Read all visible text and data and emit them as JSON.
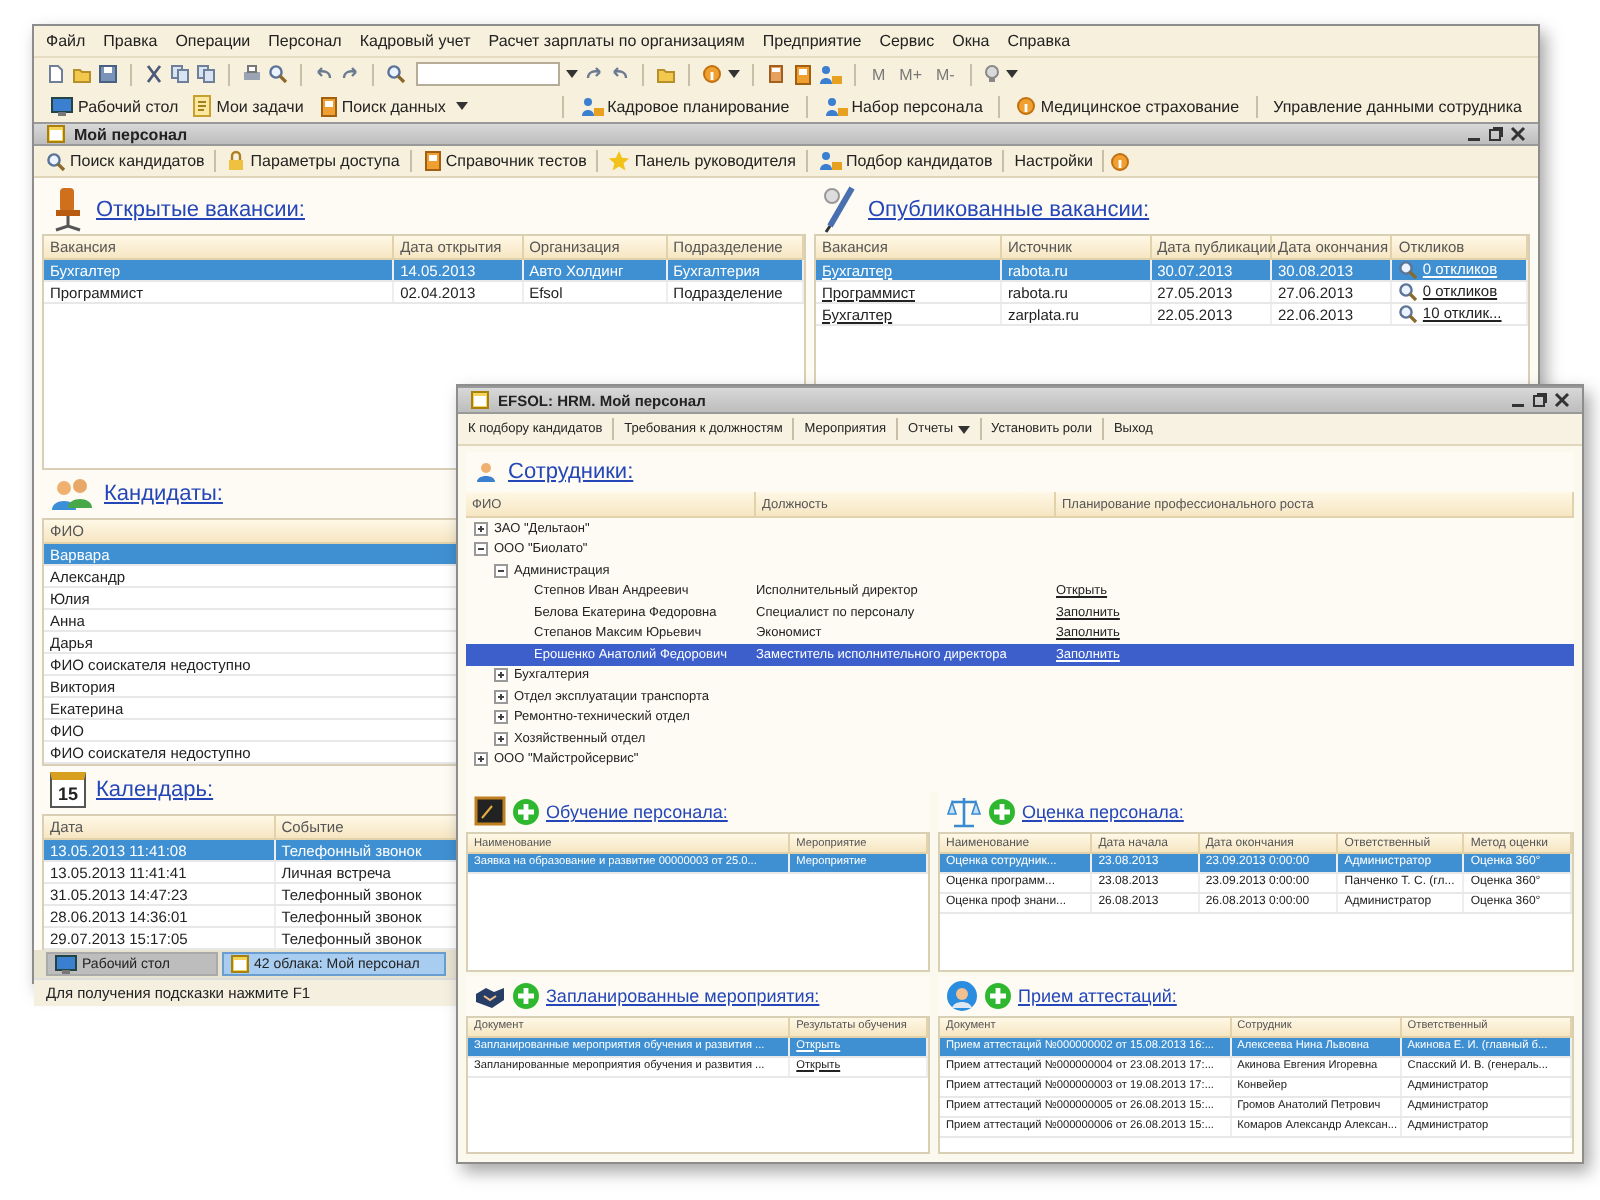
{
  "main_window": {
    "menu": [
      "Файл",
      "Правка",
      "Операции",
      "Персонал",
      "Кадровый учет",
      "Расчет зарплаты по организациям",
      "Предприятие",
      "Сервис",
      "Окна",
      "Справка"
    ],
    "memory_buttons": [
      "M",
      "M+",
      "M-"
    ],
    "shortcuts": [
      "Рабочий стол",
      "Мои задачи",
      "Поиск данных"
    ],
    "quick_links": [
      "Кадровое планирование",
      "Набор персонала",
      "Медицинское страхование",
      "Управление данными сотрудника"
    ],
    "title": "Мой персонал",
    "command_bar": [
      "Поиск кандидатов",
      "Параметры доступа",
      "Справочник тестов",
      "Панель руководителя",
      "Подбор кандидатов",
      "Настройки"
    ],
    "open_vacancies": {
      "title": "Открытые вакансии:",
      "columns": [
        "Вакансия",
        "Дата открытия",
        "Организация",
        "Подразделение"
      ],
      "rows": [
        {
          "cells": [
            "Бухгалтер",
            "14.05.2013",
            "Авто Холдинг",
            "Бухгалтерия"
          ],
          "selected": true
        },
        {
          "cells": [
            "Программист",
            "02.04.2013",
            "Efsol",
            "Подразделение"
          ],
          "selected": false
        }
      ]
    },
    "published_vacancies": {
      "title": "Опубликованные вакансии:",
      "columns": [
        "Вакансия",
        "Источник",
        "Дата публикации",
        "Дата окончания",
        "Откликов"
      ],
      "rows": [
        {
          "cells": [
            "Бухгалтер",
            "rabota.ru",
            "30.07.2013",
            "30.08.2013",
            "0 откликов"
          ],
          "selected": true
        },
        {
          "cells": [
            "Программист",
            "rabota.ru",
            "27.05.2013",
            "27.06.2013",
            "0 откликов"
          ],
          "selected": false
        },
        {
          "cells": [
            "Бухгалтер",
            "zarplata.ru",
            "22.05.2013",
            "22.06.2013",
            "10 отклик..."
          ],
          "selected": false
        }
      ]
    },
    "candidates": {
      "title": "Кандидаты:",
      "columns": [
        "ФИО"
      ],
      "rows": [
        {
          "cells": [
            "Варвара"
          ],
          "selected": true
        },
        {
          "cells": [
            "Александр"
          ],
          "selected": false
        },
        {
          "cells": [
            "Юлия"
          ],
          "selected": false
        },
        {
          "cells": [
            "Анна"
          ],
          "selected": false
        },
        {
          "cells": [
            "Дарья"
          ],
          "selected": false
        },
        {
          "cells": [
            "ФИО соискателя недоступно"
          ],
          "selected": false
        },
        {
          "cells": [
            "Виктория"
          ],
          "selected": false
        },
        {
          "cells": [
            "Екатерина"
          ],
          "selected": false
        },
        {
          "cells": [
            "ФИО"
          ],
          "selected": false
        },
        {
          "cells": [
            "ФИО соискателя недоступно"
          ],
          "selected": false
        }
      ]
    },
    "calendar": {
      "title": "Календарь:",
      "day": "15",
      "columns": [
        "Дата",
        "Событие"
      ],
      "rows": [
        {
          "cells": [
            "13.05.2013 11:41:08",
            "Телефонный звонок"
          ],
          "selected": true
        },
        {
          "cells": [
            "13.05.2013 11:41:41",
            "Личная встреча"
          ],
          "selected": false
        },
        {
          "cells": [
            "31.05.2013 14:47:23",
            "Телефонный звонок"
          ],
          "selected": false
        },
        {
          "cells": [
            "28.06.2013 14:36:01",
            "Телефонный звонок"
          ],
          "selected": false
        },
        {
          "cells": [
            "29.07.2013 15:17:05",
            "Телефонный звонок"
          ],
          "selected": false
        }
      ]
    },
    "taskbar": [
      {
        "label": "Рабочий стол",
        "selected": false
      },
      {
        "label": "42 облака: Мой персонал",
        "selected": true
      }
    ],
    "status_bar": "Для получения подсказки нажмите F1"
  },
  "front_window": {
    "title": "EFSOL: HRM. Мой персонал",
    "toolbar": [
      {
        "label": "К подбору кандидатов",
        "dropdown": false
      },
      {
        "label": "Требования к должностям",
        "dropdown": false
      },
      {
        "label": "Мероприятия",
        "dropdown": false
      },
      {
        "label": "Отчеты",
        "dropdown": true
      },
      {
        "label": "Установить роли",
        "dropdown": false
      },
      {
        "label": "Выход",
        "dropdown": false
      }
    ],
    "employees": {
      "title": "Сотрудники:",
      "columns": [
        "ФИО",
        "Должность",
        "Планирование профессионального роста"
      ],
      "tree": [
        {
          "name": "ЗАО \"Дельтаон\"",
          "expanded": false
        },
        {
          "name": "ООО \"Биолато\"",
          "expanded": true,
          "children": [
            {
              "name": "Администрация",
              "expanded": true,
              "children": [
                {
                  "name": "Степнов Иван Андреевич",
                  "position": "Исполнительный директор",
                  "action": "Открыть",
                  "selected": false
                },
                {
                  "name": "Белова Екатерина Федоровна",
                  "position": "Специалист по персоналу",
                  "action": "Заполнить",
                  "selected": false
                },
                {
                  "name": "Степанов Максим Юрьевич",
                  "position": "Экономист",
                  "action": "Заполнить",
                  "selected": false
                },
                {
                  "name": "Ерошенко Анатолий Федорович",
                  "position": "Заместитель исполнительного директора",
                  "action": "Заполнить",
                  "selected": true
                }
              ]
            },
            {
              "name": "Бухгалтерия",
              "expanded": false
            },
            {
              "name": "Отдел эксплуатации транспорта",
              "expanded": false
            },
            {
              "name": "Ремонтно-технический отдел",
              "expanded": false
            },
            {
              "name": "Хозяйственный отдел",
              "expanded": false
            }
          ]
        },
        {
          "name": "ООО \"Майстройсервис\"",
          "expanded": false
        }
      ]
    },
    "training": {
      "title": "Обучение персонала:",
      "columns": [
        "Наименование",
        "Мероприятие"
      ],
      "rows": [
        {
          "cells": [
            "Заявка на образование и развитие 00000003 от 25.0...",
            "Мероприятие"
          ],
          "selected": true
        }
      ]
    },
    "assessment": {
      "title": "Оценка персонала:",
      "columns": [
        "Наименование",
        "Дата начала",
        "Дата окончания",
        "Ответственный",
        "Метод оценки"
      ],
      "rows": [
        {
          "cells": [
            "Оценка сотрудник...",
            "23.08.2013",
            "23.09.2013 0:00:00",
            "Администратор",
            "Оценка 360°"
          ],
          "selected": true
        },
        {
          "cells": [
            "Оценка программ...",
            "23.08.2013",
            "23.09.2013 0:00:00",
            "Панченко Т. С. (гл...",
            "Оценка 360°"
          ],
          "selected": false
        },
        {
          "cells": [
            "Оценка проф знани...",
            "26.08.2013",
            "26.08.2013 0:00:00",
            "Администратор",
            "Оценка 360°"
          ],
          "selected": false
        }
      ]
    },
    "events": {
      "title": "Запланированные мероприятия:",
      "columns": [
        "Документ",
        "Результаты обучения"
      ],
      "rows": [
        {
          "cells": [
            "Запланированные мероприятия обучения и развития ...",
            "Открыть"
          ],
          "selected": true
        },
        {
          "cells": [
            "Запланированные мероприятия обучения и развития ...",
            "Открыть"
          ],
          "selected": false
        }
      ]
    },
    "attestations": {
      "title": "Прием аттестаций:",
      "columns": [
        "Документ",
        "Сотрудник",
        "Ответственный"
      ],
      "rows": [
        {
          "cells": [
            "Прием аттестаций №000000002 от 15.08.2013 16:...",
            "Алексеева Нина Львовна",
            "Акинова Е. И. (главный б..."
          ],
          "selected": true
        },
        {
          "cells": [
            "Прием аттестаций №000000004 от 23.08.2013 17:...",
            "Акинова Евгения Игоревна",
            "Спасский И. В. (генераль..."
          ],
          "selected": false
        },
        {
          "cells": [
            "Прием аттестаций №000000003 от 19.08.2013 17:...",
            "Конвейер",
            "Администратор"
          ],
          "selected": false
        },
        {
          "cells": [
            "Прием аттестаций №000000005 от 26.08.2013 15:...",
            "Громов Анатолий Петрович",
            "Администратор"
          ],
          "selected": false
        },
        {
          "cells": [
            "Прием аттестаций №000000006 от 26.08.2013 15:...",
            "Комаров Александр Алексан...",
            "Администратор"
          ],
          "selected": false
        }
      ]
    }
  }
}
